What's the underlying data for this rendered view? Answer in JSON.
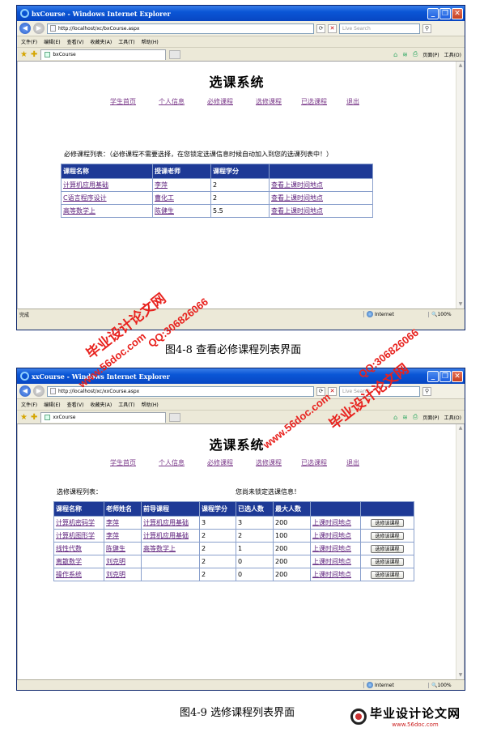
{
  "browser": {
    "window_title": "bxCourse - Windows Internet Explorer",
    "window_title_2": "xxCourse - Windows Internet Explorer",
    "url": "http://localhost/xc/bxCourse.aspx",
    "url_2": "http://localhost/xc/xxCourse.aspx",
    "search_placeholder": "Live Search",
    "menu": [
      "文件(F)",
      "编辑(E)",
      "查看(V)",
      "收藏夹(A)",
      "工具(T)",
      "帮助(H)"
    ],
    "tab_title": "bxCourse",
    "tab_title_2": "xxCourse",
    "cmd": {
      "page": "页面(P)",
      "tools": "工具(O)"
    },
    "status_left": "完成",
    "zone": "Internet",
    "zoom": "100%"
  },
  "site": {
    "title": "选课系统",
    "nav": [
      "学生首页",
      "个人信息",
      "必修课程",
      "选修课程",
      "已选课程",
      "退出"
    ]
  },
  "required": {
    "intro": "必修课程列表：（必修课程不需要选择，在您锁定选课信息时候自动加入到您的选课列表中！）",
    "headers": [
      "课程名称",
      "授课老师",
      "课程学分",
      ""
    ],
    "rows": [
      {
        "name": "计算机应用基础",
        "teacher": "李萍",
        "credit": "2",
        "action": "查看上课时间地点"
      },
      {
        "name": "C语言程序设计",
        "teacher": "曹化工",
        "credit": "2",
        "action": "查看上课时间地点"
      },
      {
        "name": "高等数学上",
        "teacher": "陈健生",
        "credit": "5.5",
        "action": "查看上课时间地点"
      }
    ]
  },
  "elective": {
    "intro": "选修课程列表：",
    "lock_note": "您尚未锁定选课信息！",
    "headers": [
      "课程名称",
      "老师姓名",
      "前导课程",
      "课程学分",
      "已选人数",
      "最大人数",
      "",
      ""
    ],
    "rows": [
      {
        "name": "计算机密码学",
        "teacher": "李萍",
        "prereq": "计算机应用基础",
        "credit": "3",
        "selected": "3",
        "max": "200",
        "place": "上课时间地点",
        "btn": "选修该课程"
      },
      {
        "name": "计算机图形学",
        "teacher": "李萍",
        "prereq": "计算机应用基础",
        "credit": "2",
        "selected": "2",
        "max": "100",
        "place": "上课时间地点",
        "btn": "选修该课程"
      },
      {
        "name": "线性代数",
        "teacher": "陈健生",
        "prereq": "高等数学上",
        "credit": "2",
        "selected": "1",
        "max": "200",
        "place": "上课时间地点",
        "btn": "选修该课程"
      },
      {
        "name": "离散数学",
        "teacher": "刘克明",
        "prereq": "",
        "credit": "2",
        "selected": "0",
        "max": "200",
        "place": "上课时间地点",
        "btn": "选修该课程"
      },
      {
        "name": "操作系统",
        "teacher": "刘克明",
        "prereq": "",
        "credit": "2",
        "selected": "0",
        "max": "200",
        "place": "上课时间地点",
        "btn": "选修该课程"
      }
    ]
  },
  "captions": {
    "fig1": "图4-8  查看必修课程列表界面",
    "fig2": "图4-9  选修课程列表界面"
  },
  "watermarks": {
    "site": "毕业设计论文网",
    "url": "www.56doc.com",
    "qq": "QQ:306826066",
    "logo_cn": "毕业设计论文网",
    "logo_url": "www.56doc.com",
    "color_red": "#e8221e",
    "color_blue": "#1a3bd6"
  }
}
